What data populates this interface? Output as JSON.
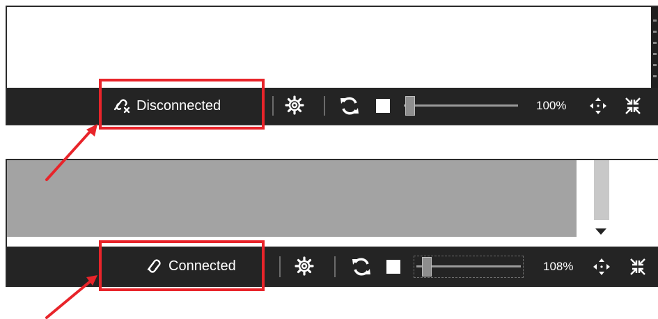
{
  "top_panel": {
    "status_text": "Disconnected",
    "status_icon": "link-broken-icon",
    "zoom_text": "100%",
    "slider_value_percent": 100
  },
  "bottom_panel": {
    "status_text": "Connected",
    "status_icon": "link-icon",
    "zoom_text": "108%",
    "slider_value_percent": 108
  },
  "icons": {
    "settings": "gear-icon",
    "refresh": "refresh-icon",
    "stop": "stop-icon",
    "fit": "fit-to-screen-icon",
    "collapse": "collapse-icon"
  },
  "colors": {
    "statusbar_bg": "#242424",
    "highlight": "#e8242a",
    "text": "#ffffff"
  }
}
